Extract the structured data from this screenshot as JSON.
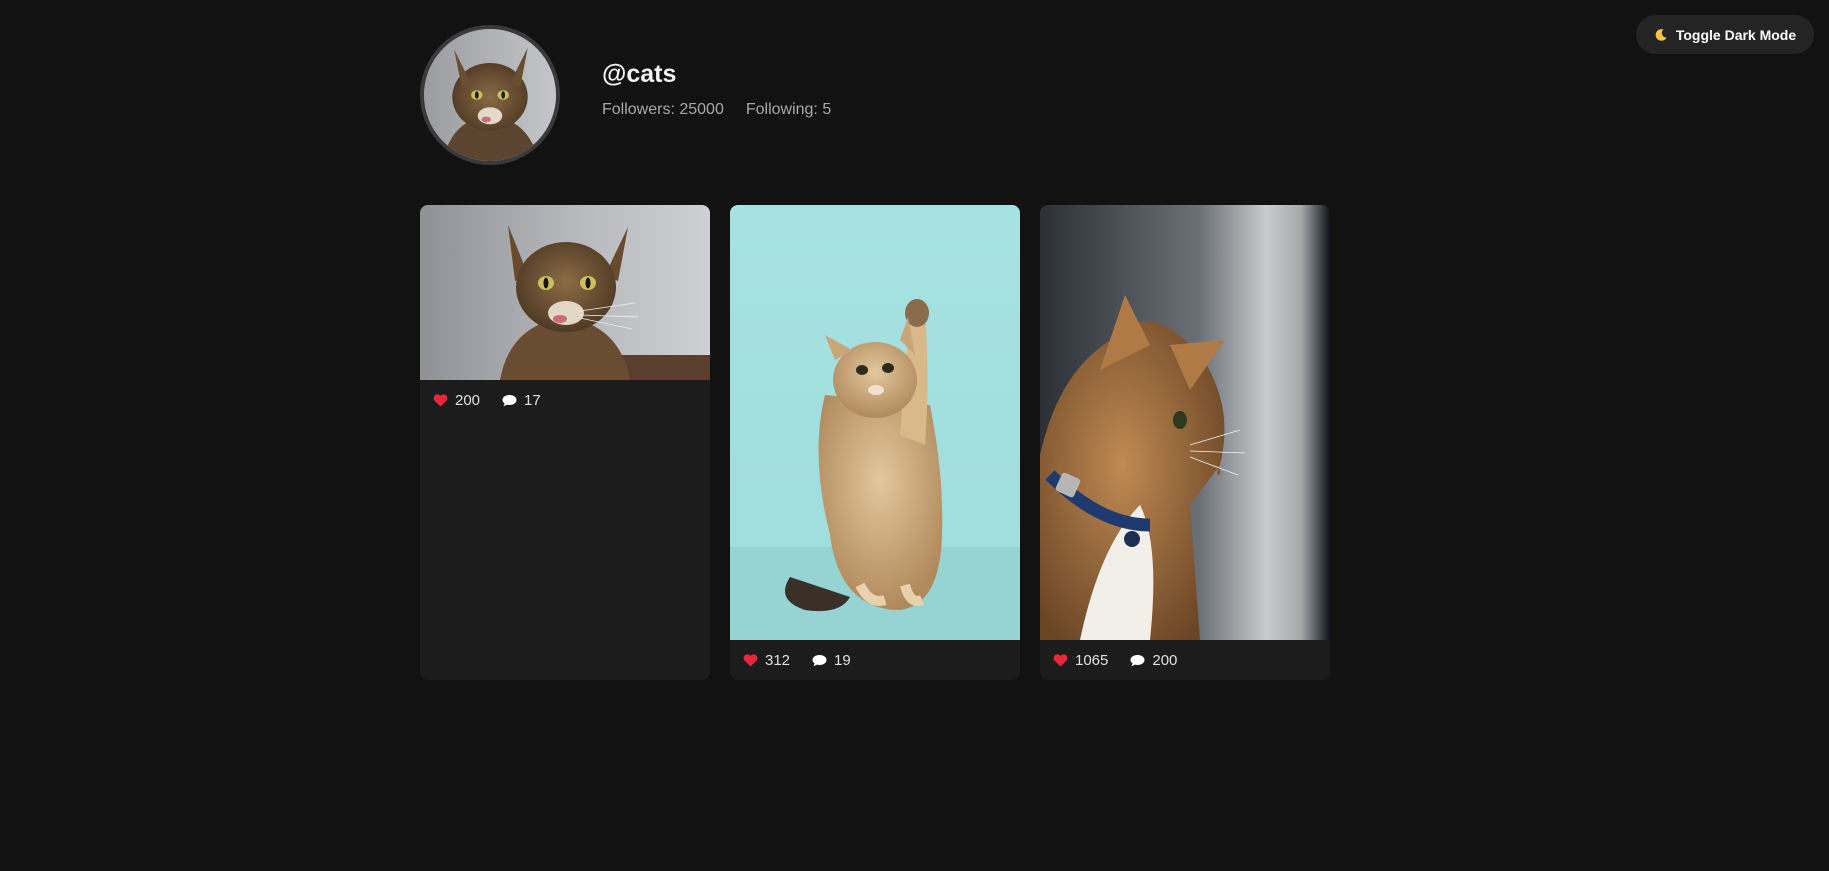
{
  "toolbar": {
    "toggle_label": "Toggle Dark Mode",
    "toggle_icon": "moon-icon"
  },
  "profile": {
    "username": "@cats",
    "followers": "Followers: 25000",
    "following": "Following: 5",
    "avatar": "cat-avatar-image"
  },
  "posts": [
    {
      "image": "tabby-cat-licking-photo",
      "likes": "200",
      "comments": "17"
    },
    {
      "image": "kitten-raising-paw-photo",
      "likes": "312",
      "comments": "19"
    },
    {
      "image": "ginger-cat-profile-photo",
      "likes": "1065",
      "comments": "200"
    }
  ],
  "colors": {
    "background": "#121212",
    "card": "#1c1c1c",
    "heart": "#e8273a",
    "text": "#e6e6e6",
    "muted": "#a8a8a8"
  }
}
